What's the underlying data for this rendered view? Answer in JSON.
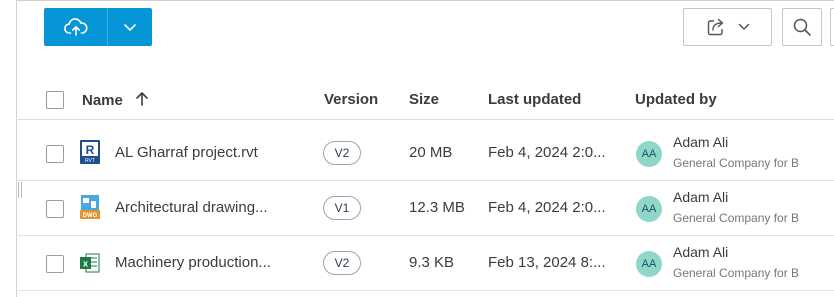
{
  "toolbar": {
    "upload_icon": "cloud-upload-icon",
    "dropdown_icon": "chevron-down-icon",
    "share_icon": "share-icon",
    "share_dropdown_icon": "chevron-down-icon",
    "search_icon": "search-icon",
    "accent": "#0696d7"
  },
  "table": {
    "columns": {
      "name": "Name",
      "sort_icon": "arrow-up-icon",
      "version": "Version",
      "size": "Size",
      "last_updated": "Last updated",
      "updated_by": "Updated by"
    },
    "rows": [
      {
        "icon": "revit-file-icon",
        "name": "AL Gharraf project.rvt",
        "version": "V2",
        "size": "20 MB",
        "last_updated": "Feb 4, 2024 2:0...",
        "avatar": "AA",
        "user": "Adam Ali",
        "company": "General Company for B"
      },
      {
        "icon": "dwg-file-icon",
        "name": "Architectural drawing...",
        "version": "V1",
        "size": "12.3 MB",
        "last_updated": "Feb 4, 2024 2:0...",
        "avatar": "AA",
        "user": "Adam Ali",
        "company": "General Company for B"
      },
      {
        "icon": "excel-file-icon",
        "name": "Machinery production...",
        "version": "V2",
        "size": "9.3 KB",
        "last_updated": "Feb 13, 2024 8:...",
        "avatar": "AA",
        "user": "Adam Ali",
        "company": "General Company for B"
      }
    ]
  }
}
